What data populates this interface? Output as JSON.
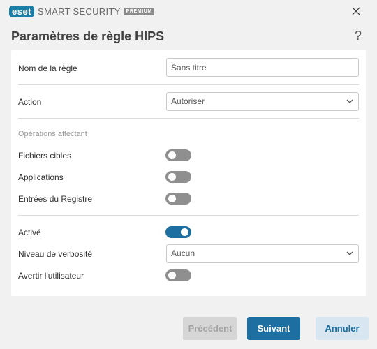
{
  "window": {
    "brand": "eset",
    "product": "SMART SECURITY",
    "tier": "PREMIUM"
  },
  "header": {
    "title": "Paramètres de règle HIPS",
    "help": "?"
  },
  "form": {
    "rule_name_label": "Nom de la règle",
    "rule_name_value": "Sans titre",
    "action_label": "Action",
    "action_value": "Autoriser",
    "operations_section": "Opérations affectant",
    "target_files_label": "Fichiers cibles",
    "target_files_on": false,
    "applications_label": "Applications",
    "applications_on": false,
    "registry_label": "Entrées du Registre",
    "registry_on": false,
    "enabled_label": "Activé",
    "enabled_on": true,
    "verbosity_label": "Niveau de verbosité",
    "verbosity_value": "Aucun",
    "notify_label": "Avertir l'utilisateur",
    "notify_on": false
  },
  "footer": {
    "previous": "Précédent",
    "next": "Suivant",
    "cancel": "Annuler"
  },
  "colors": {
    "accent": "#1c6fa0",
    "toggle_off": "#8f8f8f",
    "brand_badge": "#1a7fa6"
  }
}
